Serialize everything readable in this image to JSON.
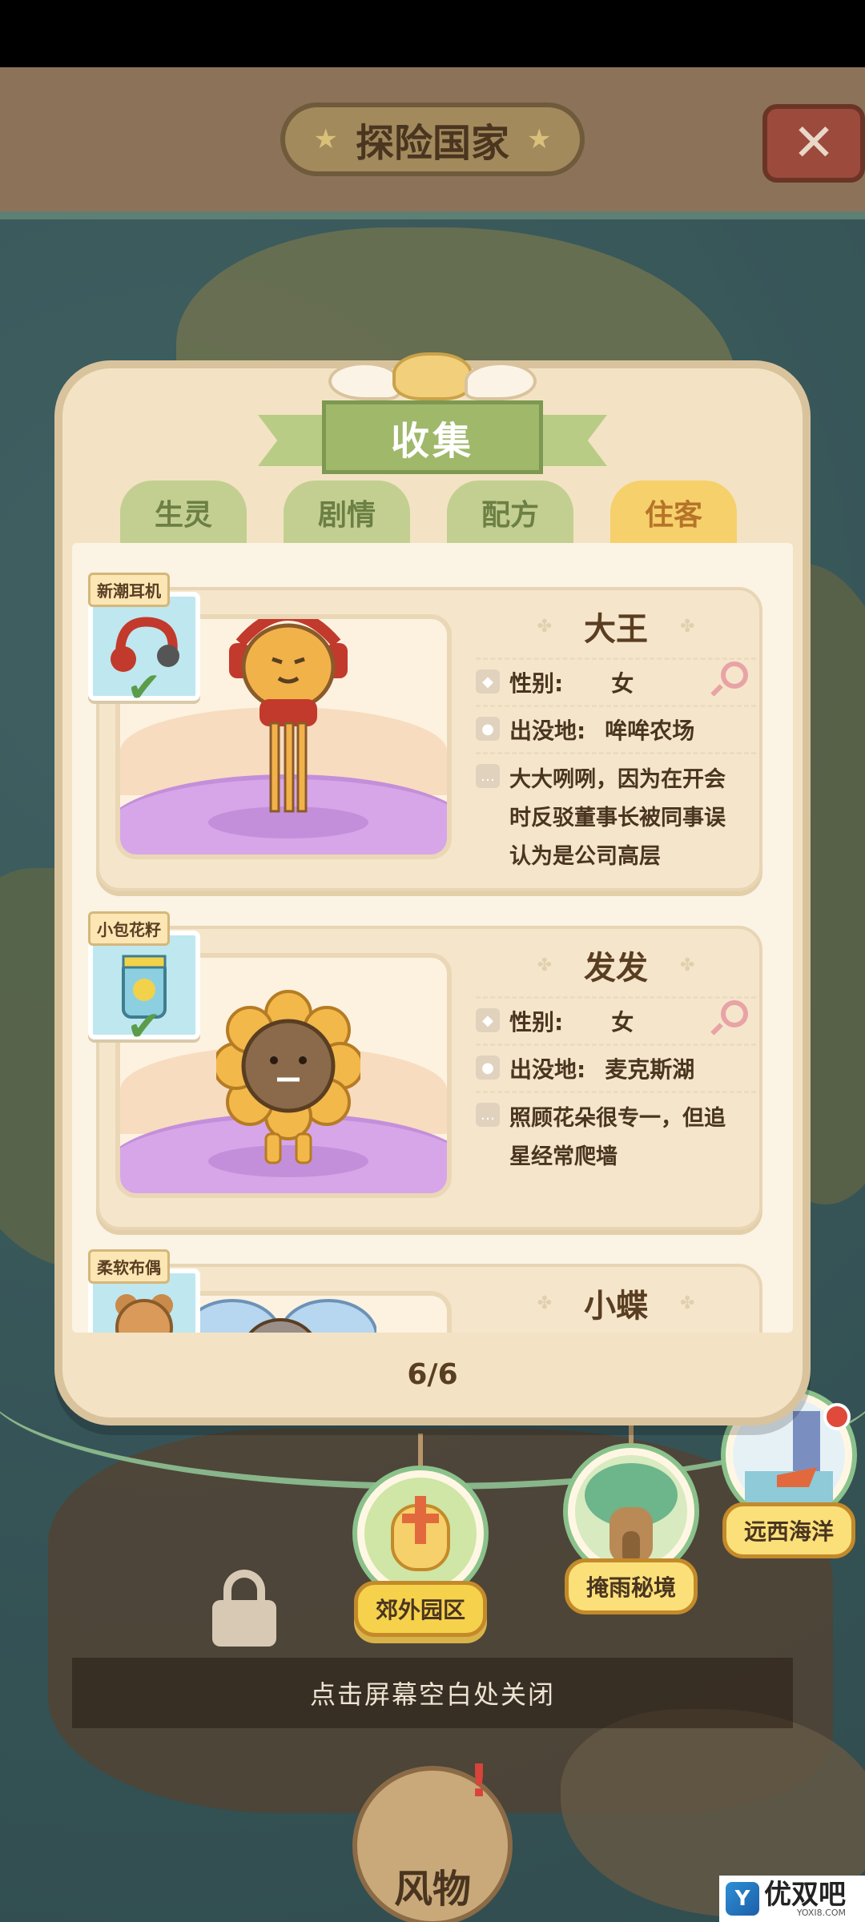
{
  "header": {
    "title": "探险国家",
    "close_label": "✕"
  },
  "modal": {
    "title": "收集",
    "tabs": [
      {
        "label": "生灵",
        "active": false
      },
      {
        "label": "剧情",
        "active": false
      },
      {
        "label": "配方",
        "active": false
      },
      {
        "label": "住客",
        "active": true
      }
    ],
    "cards": [
      {
        "badge": "新潮耳机",
        "collected": true,
        "name": "大王",
        "gender_label": "性别:",
        "gender": "女",
        "location_label": "出没地:",
        "location": "哞哞农场",
        "desc_lines": [
          "大大咧咧，因为在开会",
          "时反驳董事长被同事误",
          "认为是公司高层"
        ]
      },
      {
        "badge": "小包花籽",
        "collected": true,
        "name": "发发",
        "gender_label": "性别:",
        "gender": "女",
        "location_label": "出没地:",
        "location": "麦克斯湖",
        "desc_lines": [
          "照顾花朵很专一，但追",
          "星经常爬墙"
        ]
      },
      {
        "badge": "柔软布偶",
        "name": "小蝶"
      }
    ],
    "pager": "6/6"
  },
  "regions": [
    {
      "label": "郊外园区",
      "active": true
    },
    {
      "label": "掩雨秘境",
      "active": false
    },
    {
      "label": "远西海洋",
      "active": false,
      "has_alert": true
    }
  ],
  "hint": "点击屏幕空白处关闭",
  "bottom_button": "风物",
  "watermark": {
    "logo": "Y",
    "text": "优双吧",
    "url_text": "YOXI8.COM"
  },
  "colors": {
    "active_tab": "#f6d06a",
    "inactive_tab": "#c3cf91",
    "ribbon": "#9fb86a",
    "modal_bg": "#f3e3c4"
  }
}
